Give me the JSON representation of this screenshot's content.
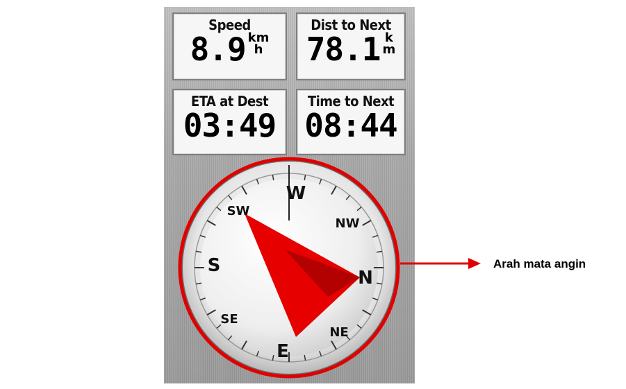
{
  "fields": {
    "speed": {
      "label": "Speed",
      "value": "8.9",
      "unit_top": "km",
      "unit_bottom": "h"
    },
    "dist_to_next": {
      "label": "Dist to Next",
      "value": "78.1",
      "unit_top": "k",
      "unit_bottom": "m"
    },
    "eta_at_dest": {
      "label": "ETA at Dest",
      "value": "03:49"
    },
    "time_to_next": {
      "label": "Time to Next",
      "value": "08:44"
    }
  },
  "compass": {
    "labels": {
      "W": "W",
      "NW": "NW",
      "N": "N",
      "NE": "NE",
      "E": "E",
      "SE": "SE",
      "S": "S",
      "SW": "SW"
    },
    "pointer_color": "#e60000",
    "pointer_shade_color": "#b30000",
    "highlight_ring_color": "#e00000"
  },
  "callout": {
    "label": "Arah mata angin",
    "arrow_color": "#e00000"
  }
}
